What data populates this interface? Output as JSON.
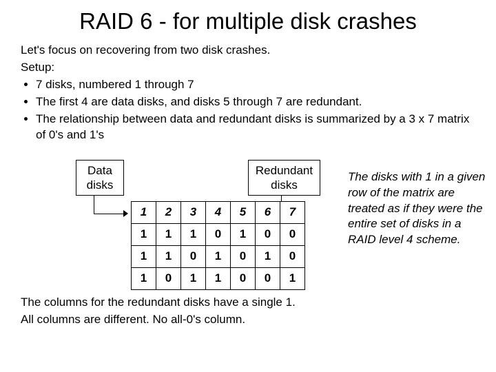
{
  "title": "RAID 6 - for multiple disk crashes",
  "intro": {
    "line1": "Let's focus on recovering from two disk crashes.",
    "line2": "Setup:",
    "bullets": [
      "7 disks, numbered 1 through 7",
      "The first 4 are data disks, and disks 5 through 7 are redundant.",
      "The relationship between data and redundant disks is summarized by a 3 x 7 matrix of 0's and 1's"
    ]
  },
  "labels": {
    "data": "Data disks",
    "redundant": "Redundant disks"
  },
  "matrix": {
    "header": [
      "1",
      "2",
      "3",
      "4",
      "5",
      "6",
      "7"
    ],
    "rows": [
      [
        "1",
        "1",
        "1",
        "0",
        "1",
        "0",
        "0"
      ],
      [
        "1",
        "1",
        "0",
        "1",
        "0",
        "1",
        "0"
      ],
      [
        "1",
        "0",
        "1",
        "1",
        "0",
        "0",
        "1"
      ]
    ]
  },
  "side_note": "The disks with 1 in a given row of the matrix are treated as if they were the entire set of disks in a RAID level 4 scheme.",
  "footer": {
    "line1": "The columns for the redundant disks have a single 1.",
    "line2": "All columns are different. No all-0's column."
  }
}
